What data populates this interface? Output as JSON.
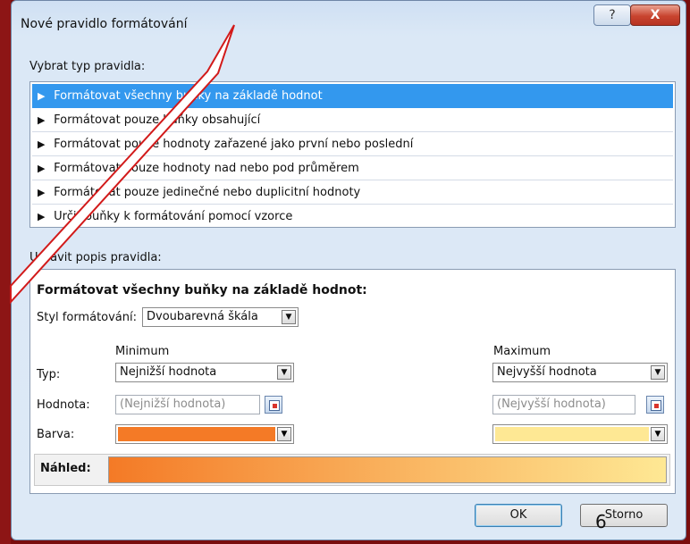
{
  "dialog": {
    "title": "Nové pravidlo formátování",
    "help_label": "?",
    "close_label": "X"
  },
  "select_type": {
    "label": "Vybrat typ pravidla:",
    "items": [
      {
        "label": "Formátovat všechny buňky na základě hodnot",
        "selected": true
      },
      {
        "label": "Formátovat pouze buňky obsahující",
        "selected": false
      },
      {
        "label": "Formátovat pouze hodnoty zařazené jako první nebo poslední",
        "selected": false
      },
      {
        "label": "Formátovat pouze hodnoty nad nebo pod průměrem",
        "selected": false
      },
      {
        "label": "Formátovat pouze jedinečné nebo duplicitní hodnoty",
        "selected": false
      },
      {
        "label": "Určit buňky k formátování pomocí vzorce",
        "selected": false
      }
    ]
  },
  "edit_desc": {
    "label": "Upravit popis pravidla:",
    "heading": "Formátovat všechny buňky na základě hodnot:",
    "style_label": "Styl formátování:",
    "style_value": "Dvoubarevná škála",
    "minimum_header": "Minimum",
    "maximum_header": "Maximum",
    "type_label": "Typ:",
    "value_label": "Hodnota:",
    "color_label": "Barva:",
    "min_type": "Nejnižší hodnota",
    "max_type": "Nejvyšší hodnota",
    "min_value_placeholder": "(Nejnižší hodnota)",
    "max_value_placeholder": "(Nejvyšší hodnota)",
    "min_color": "#f47a26",
    "max_color": "#fee894",
    "preview_label": "Náhled:"
  },
  "buttons": {
    "ok": "OK",
    "cancel": "Storno"
  },
  "slide_number": "6"
}
